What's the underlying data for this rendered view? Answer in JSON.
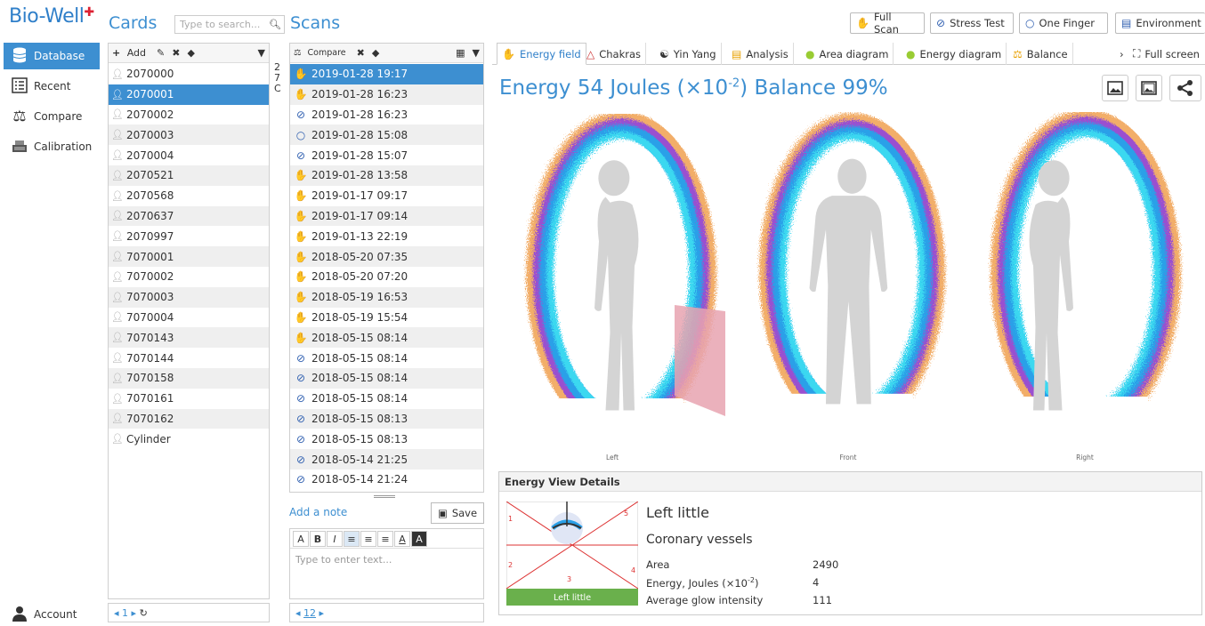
{
  "app": {
    "logo": "Bio-Well"
  },
  "sidebar": {
    "items": [
      {
        "label": "Database",
        "icon": "database-icon"
      },
      {
        "label": "Recent",
        "icon": "list-icon"
      },
      {
        "label": "Compare",
        "icon": "scales-icon"
      },
      {
        "label": "Calibration",
        "icon": "calibration-icon"
      }
    ],
    "account_label": "Account"
  },
  "cards": {
    "title": "Cards",
    "search_placeholder": "Type to search...",
    "add_label": "Add",
    "items": [
      "2070000",
      "2070001",
      "2070002",
      "2070003",
      "2070004",
      "2070521",
      "2070568",
      "2070637",
      "2070997",
      "7070001",
      "7070002",
      "7070003",
      "7070004",
      "7070143",
      "7070144",
      "7070158",
      "7070161",
      "7070162",
      "Cylinder"
    ],
    "selected_index": 1,
    "side_letters": [
      "2",
      "7",
      "C"
    ],
    "pager": "1"
  },
  "scans": {
    "title": "Scans",
    "compare_label": "Compare",
    "items": [
      {
        "date": "2019-01-28 19:17",
        "type": "full-scan"
      },
      {
        "date": "2019-01-28 16:23",
        "type": "full-scan"
      },
      {
        "date": "2019-01-28 16:23",
        "type": "stress-test"
      },
      {
        "date": "2019-01-28 15:08",
        "type": "one-finger"
      },
      {
        "date": "2019-01-28 15:07",
        "type": "stress-test"
      },
      {
        "date": "2019-01-28 13:58",
        "type": "full-scan"
      },
      {
        "date": "2019-01-17 09:17",
        "type": "full-scan"
      },
      {
        "date": "2019-01-17 09:14",
        "type": "full-scan"
      },
      {
        "date": "2019-01-13 22:19",
        "type": "full-scan"
      },
      {
        "date": "2018-05-20 07:35",
        "type": "full-scan"
      },
      {
        "date": "2018-05-20 07:20",
        "type": "full-scan"
      },
      {
        "date": "2018-05-19 16:53",
        "type": "full-scan"
      },
      {
        "date": "2018-05-19 15:54",
        "type": "full-scan"
      },
      {
        "date": "2018-05-15 08:14",
        "type": "full-scan"
      },
      {
        "date": "2018-05-15 08:14",
        "type": "stress-test"
      },
      {
        "date": "2018-05-15 08:14",
        "type": "stress-test"
      },
      {
        "date": "2018-05-15 08:14",
        "type": "stress-test"
      },
      {
        "date": "2018-05-15 08:13",
        "type": "stress-test"
      },
      {
        "date": "2018-05-15 08:13",
        "type": "stress-test"
      },
      {
        "date": "2018-05-14 21:25",
        "type": "stress-test"
      },
      {
        "date": "2018-05-14 21:24",
        "type": "stress-test"
      }
    ],
    "selected_index": 0,
    "add_note_label": "Add a note",
    "save_label": "Save",
    "note_placeholder": "Type to enter text...",
    "pager": "12"
  },
  "toolbar": {
    "full_scan": "Full Scan",
    "stress_test": "Stress Test",
    "one_finger": "One Finger",
    "environment": "Environment"
  },
  "tabs": [
    "Energy field",
    "Chakras",
    "Yin Yang",
    "Analysis",
    "Area diagram",
    "Energy diagram",
    "Balance"
  ],
  "active_tab": 0,
  "full_screen_label": "Full screen",
  "main": {
    "headline_prefix": "Energy 54 Joules (×10",
    "headline_exp": "-2",
    "headline_suffix": ") Balance 99%",
    "views": [
      "Left",
      "Front",
      "Right"
    ]
  },
  "details": {
    "title": "Energy View Details",
    "sector_name": "Left little",
    "organ": "Coronary vessels",
    "sector_label": "Left little",
    "sector_numbers": [
      "1",
      "2",
      "3",
      "4",
      "5"
    ],
    "area_label": "Area",
    "area_value": "2490",
    "energy_label_prefix": "Energy, Joules (×10",
    "energy_label_exp": "-2",
    "energy_label_suffix": ")",
    "energy_value": "4",
    "glow_label": "Average glow intensity",
    "glow_value": "111"
  },
  "colors": {
    "accent": "#3d8fd1",
    "sector_green": "#6ab04c",
    "sector_pink": "#e8a3b0"
  }
}
